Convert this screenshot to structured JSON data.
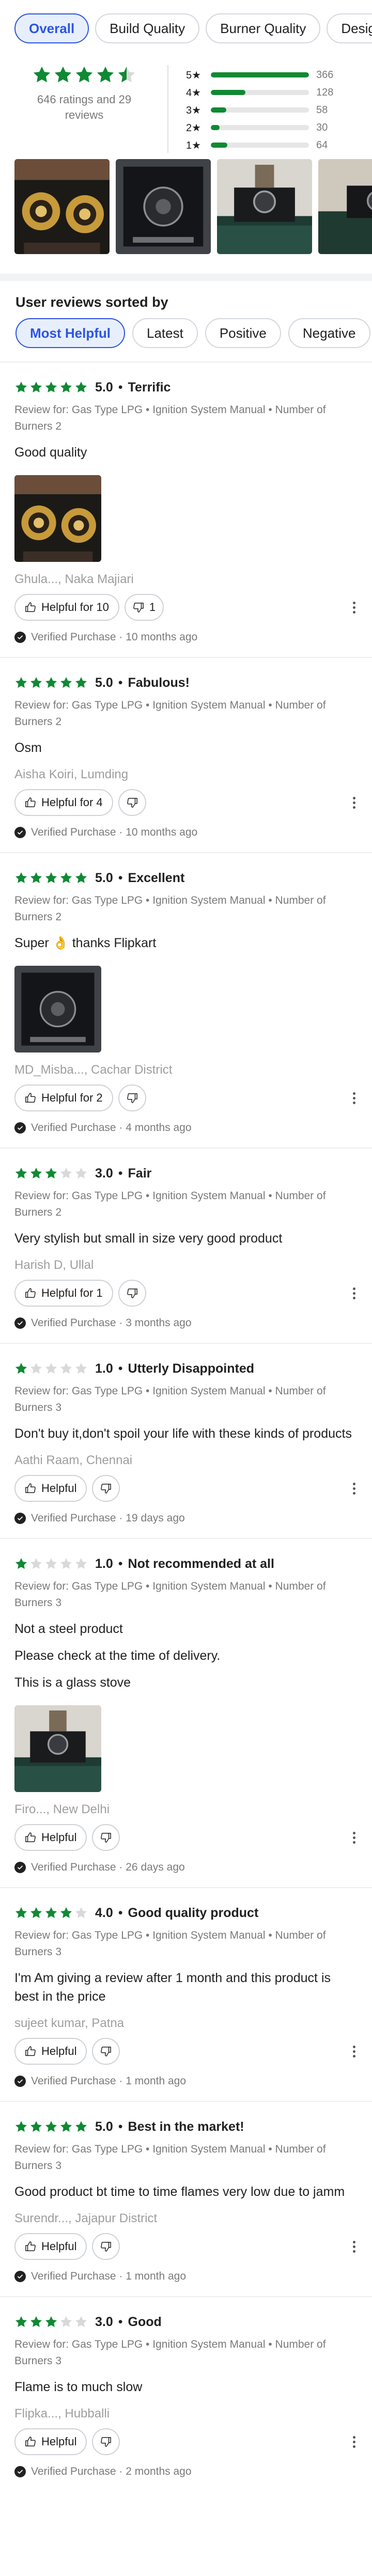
{
  "tabs": [
    {
      "label": "Overall",
      "active": true
    },
    {
      "label": "Build Quality",
      "active": false
    },
    {
      "label": "Burner Quality",
      "active": false
    },
    {
      "label": "Design",
      "active": false
    }
  ],
  "summary": {
    "average_stars": 4.5,
    "count_text": "646 ratings and 29 reviews",
    "bars": [
      {
        "label": "5★",
        "value": 366,
        "fraction": 1.0
      },
      {
        "label": "4★",
        "value": 128,
        "fraction": 0.35
      },
      {
        "label": "3★",
        "value": 58,
        "fraction": 0.16
      },
      {
        "label": "2★",
        "value": 30,
        "fraction": 0.09
      },
      {
        "label": "1★",
        "value": 64,
        "fraction": 0.17
      }
    ]
  },
  "gallery": [
    {
      "icon": "gold-burners-photo"
    },
    {
      "icon": "glass-stove-photo"
    },
    {
      "icon": "stove-on-counter-photo"
    },
    {
      "icon": "stove-partial-photo"
    }
  ],
  "sort": {
    "title": "User reviews sorted by",
    "options": [
      {
        "label": "Most Helpful",
        "active": true
      },
      {
        "label": "Latest",
        "active": false
      },
      {
        "label": "Positive",
        "active": false
      },
      {
        "label": "Negative",
        "active": false
      }
    ]
  },
  "colors": {
    "star_filled": "#108934",
    "star_empty": "#d9d9d9",
    "accent_blue": "#2a55e5"
  },
  "reviews": [
    {
      "stars": 5,
      "rating": "5.0",
      "title": "Terrific",
      "meta": "Review for: Gas Type LPG • Ignition System Manual • Number of Burners 2",
      "body": [
        "Good quality"
      ],
      "image": "gold-burners-photo",
      "author": "Ghula..., Naka Majiari",
      "helpful": "Helpful for 10",
      "unhelpful": "1",
      "verified": "Verified Purchase · 10 months ago"
    },
    {
      "stars": 5,
      "rating": "5.0",
      "title": "Fabulous!",
      "meta": "Review for: Gas Type LPG • Ignition System Manual • Number of Burners 2",
      "body": [
        "Osm"
      ],
      "image": null,
      "author": "Aisha Koiri, Lumding",
      "helpful": "Helpful for 4",
      "unhelpful": "",
      "verified": "Verified Purchase · 10 months ago"
    },
    {
      "stars": 5,
      "rating": "5.0",
      "title": "Excellent",
      "meta": "Review for: Gas Type LPG • Ignition System Manual • Number of Burners 2",
      "body": [
        "Super 👌 thanks Flipkart"
      ],
      "image": "glass-stove-photo",
      "author": "MD_Misba..., Cachar District",
      "helpful": "Helpful for 2",
      "unhelpful": "",
      "verified": "Verified Purchase · 4 months ago"
    },
    {
      "stars": 3,
      "rating": "3.0",
      "title": "Fair",
      "meta": "Review for: Gas Type LPG • Ignition System Manual • Number of Burners 2",
      "body": [
        "Very stylish but small in size very good product"
      ],
      "image": null,
      "author": "Harish D, Ullal",
      "helpful": "Helpful for 1",
      "unhelpful": "",
      "verified": "Verified Purchase · 3 months ago"
    },
    {
      "stars": 1,
      "rating": "1.0",
      "title": "Utterly Disappointed",
      "meta": "Review for: Gas Type LPG • Ignition System Manual • Number of Burners 3",
      "body": [
        "Don't buy it,don't spoil your life with these kinds of products"
      ],
      "image": null,
      "author": "Aathi Raam, Chennai",
      "helpful": "Helpful",
      "unhelpful": "",
      "verified": "Verified Purchase · 19 days ago"
    },
    {
      "stars": 1,
      "rating": "1.0",
      "title": "Not recommended at all",
      "meta": "Review for: Gas Type LPG • Ignition System Manual • Number of Burners 3",
      "body": [
        "Not a steel product",
        "Please check at the time of delivery.",
        "This is a glass stove"
      ],
      "image": "stove-on-counter-photo",
      "author": "Firo..., New Delhi",
      "helpful": "Helpful",
      "unhelpful": "",
      "verified": "Verified Purchase · 26 days ago"
    },
    {
      "stars": 4,
      "rating": "4.0",
      "title": "Good quality product",
      "meta": "Review for: Gas Type LPG • Ignition System Manual • Number of Burners 3",
      "body": [
        "I'm Am giving a review after 1 month and this product is best in the price"
      ],
      "image": null,
      "author": "sujeet  kumar, Patna",
      "helpful": "Helpful",
      "unhelpful": "",
      "verified": "Verified Purchase · 1 month ago"
    },
    {
      "stars": 5,
      "rating": "5.0",
      "title": "Best in the market!",
      "meta": "Review for: Gas Type LPG • Ignition System Manual • Number of Burners 3",
      "body": [
        "Good product bt time to time flames very low due to jamm"
      ],
      "image": null,
      "author": "Surendr..., Jajapur District",
      "helpful": "Helpful",
      "unhelpful": "",
      "verified": "Verified Purchase · 1 month ago"
    },
    {
      "stars": 3,
      "rating": "3.0",
      "title": "Good",
      "meta": "Review for: Gas Type LPG • Ignition System Manual • Number of Burners 3",
      "body": [
        "Flame is to much slow"
      ],
      "image": null,
      "author": "Flipka..., Hubballi",
      "helpful": "Helpful",
      "unhelpful": "",
      "verified": "Verified Purchase · 2 months ago"
    }
  ]
}
